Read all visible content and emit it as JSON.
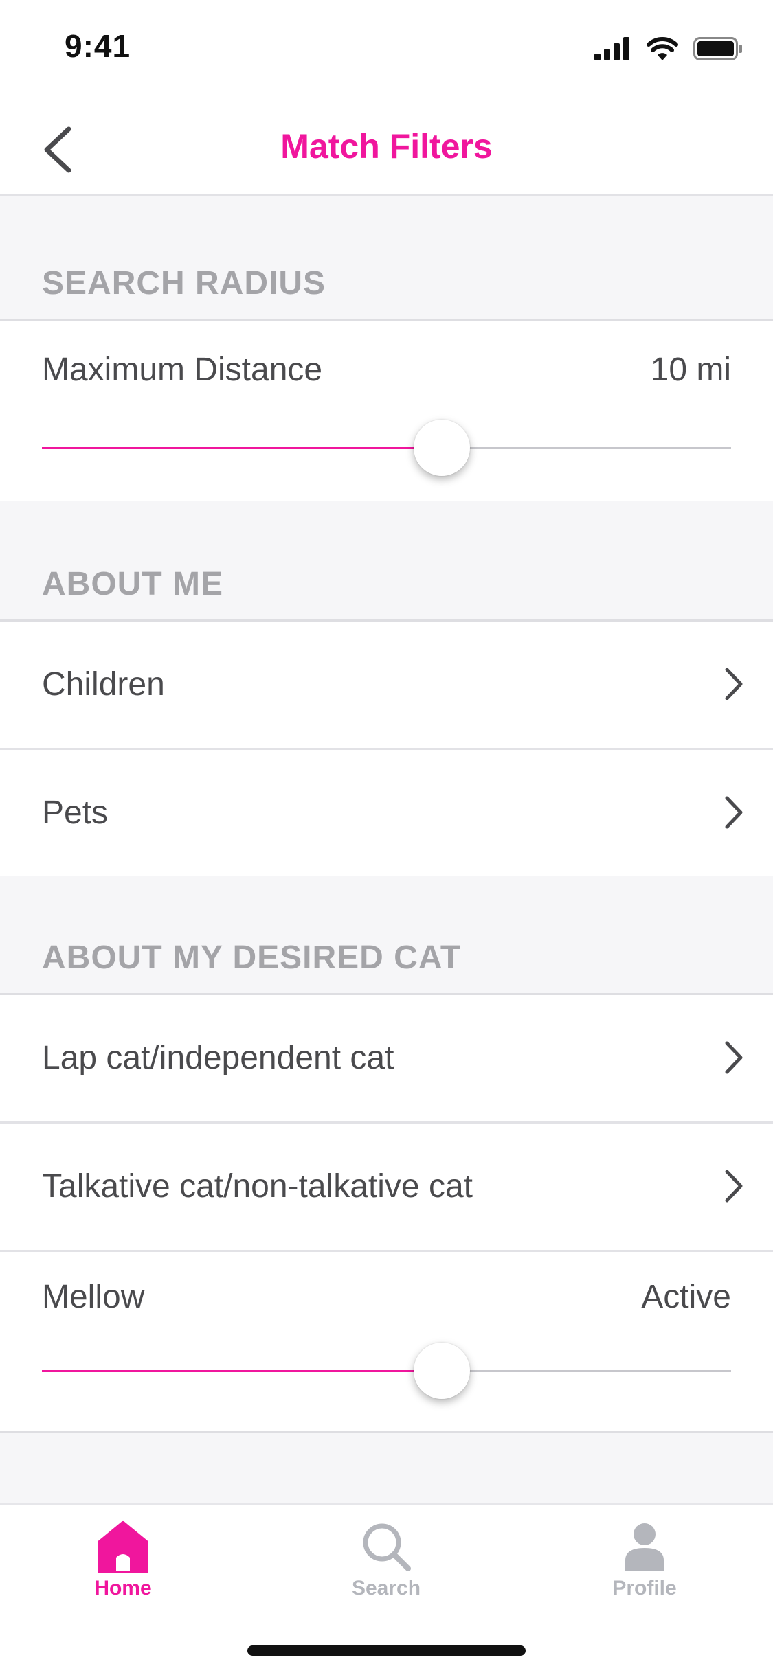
{
  "status_bar": {
    "time": "9:41"
  },
  "nav": {
    "title": "Match Filters"
  },
  "colors": {
    "accent": "#f0169d",
    "inactive": "#b4b6bc",
    "section_text": "#a4a4a8"
  },
  "search_radius": {
    "header": "SEARCH RADIUS",
    "label": "Maximum Distance",
    "value": "10 mi",
    "slider_fraction": 0.58
  },
  "about_me": {
    "header": "ABOUT ME",
    "items": [
      {
        "label": "Children"
      },
      {
        "label": "Pets"
      }
    ]
  },
  "desired_cat": {
    "header": "ABOUT MY DESIRED CAT",
    "items": [
      {
        "label": "Lap cat/independent cat"
      },
      {
        "label": "Talkative cat/non-talkative cat"
      }
    ],
    "activity": {
      "min_label": "Mellow",
      "max_label": "Active",
      "slider_fraction": 0.58
    }
  },
  "tabs": [
    {
      "label": "Home",
      "icon": "home-icon",
      "active": true
    },
    {
      "label": "Search",
      "icon": "search-icon",
      "active": false
    },
    {
      "label": "Profile",
      "icon": "profile-icon",
      "active": false
    }
  ]
}
